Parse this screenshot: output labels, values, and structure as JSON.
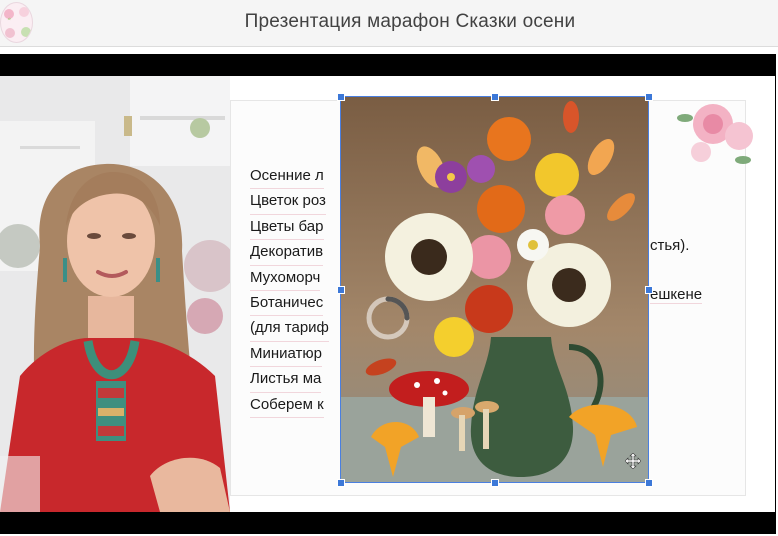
{
  "header": {
    "title": "Презентация марафон Сказки осени",
    "logo_icon": "flower-wreath-logo-icon"
  },
  "presenter": {
    "icon": "presenter-video-feed"
  },
  "slide": {
    "lines": [
      "Осенние л",
      "Цветок роз",
      "Цветы бар",
      "Декоратив",
      "Мухоморч",
      "Ботаничес",
      "(для тариф",
      "Миниатюр",
      "Листья ма",
      "Соберем к"
    ],
    "right_fragments": {
      "line4": "стья).",
      "line6": "ешкене"
    },
    "image_icon": "autumn-bouquet-vase-image",
    "loading_icon": "loading-spinner-icon",
    "move_icon": "move-cursor-icon"
  },
  "colors": {
    "header_bg": "#f5f5f5",
    "title_text": "#424242",
    "selection_blue": "#4a7fe0",
    "stage_black": "#000000"
  }
}
